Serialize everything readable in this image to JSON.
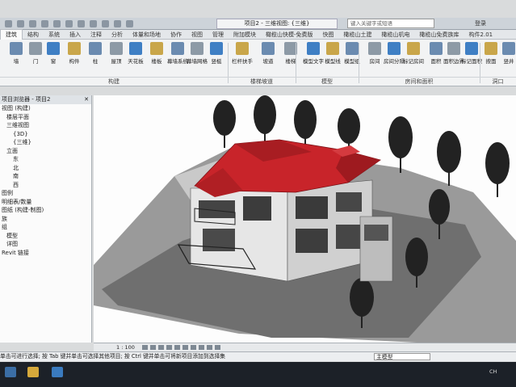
{
  "titlebar": {
    "document_title": "项目2 - 三维视图: {三维}",
    "search_placeholder": "键入关键字或短语",
    "user_label": "登录"
  },
  "ribbon_tabs": [
    {
      "label": "建筑",
      "active": true
    },
    {
      "label": "结构"
    },
    {
      "label": "系统"
    },
    {
      "label": "插入"
    },
    {
      "label": "注释"
    },
    {
      "label": "分析"
    },
    {
      "label": "体量和场地"
    },
    {
      "label": "协作"
    },
    {
      "label": "视图"
    },
    {
      "label": "管理"
    },
    {
      "label": "附加模块"
    },
    {
      "label": "橄榄山快模-免费版"
    },
    {
      "label": "快图"
    },
    {
      "label": "橄榄山土建"
    },
    {
      "label": "橄榄山机电"
    },
    {
      "label": "橄榄山免费族库"
    },
    {
      "label": "构件2.01"
    }
  ],
  "ribbon_tools": [
    {
      "label": "墙"
    },
    {
      "label": "门"
    },
    {
      "label": "窗"
    },
    {
      "label": "构件"
    },
    {
      "label": "柱"
    },
    {
      "label": "屋顶"
    },
    {
      "label": "天花板"
    },
    {
      "label": "楼板"
    },
    {
      "label": "幕墙系统"
    },
    {
      "label": "幕墙网格"
    },
    {
      "label": "竖梃"
    },
    {
      "label": "栏杆扶手"
    },
    {
      "label": "坡道"
    },
    {
      "label": "楼梯"
    },
    {
      "label": "模型文字"
    },
    {
      "label": "模型线"
    },
    {
      "label": "模型组"
    },
    {
      "label": "房间"
    },
    {
      "label": "房间分隔"
    },
    {
      "label": "标记房间"
    },
    {
      "label": "面积"
    },
    {
      "label": "面积边界"
    },
    {
      "label": "标记面积"
    },
    {
      "label": "按面"
    },
    {
      "label": "竖井"
    }
  ],
  "ribbon_groups": [
    "构建",
    "楼梯坡道",
    "模型",
    "房间和面积",
    "洞口"
  ],
  "browser": {
    "title": "项目浏览器 - 项目2",
    "close_icon": "x-icon",
    "items": [
      "视图 (构建)",
      "楼层平面",
      "三维视图",
      "{3D}",
      "{三维}",
      "立面",
      "东",
      "北",
      "南",
      "西",
      "图例",
      "明细表/数量",
      "图纸 (构建-制图)",
      "族",
      "组",
      "模型",
      "详图",
      "Revit 链接"
    ]
  },
  "viewbar": {
    "scale": "1 : 100"
  },
  "statusbar": {
    "message": "单击可进行选择; 按 Tab 键并单击可选择其他项目; 按 Ctrl 键并单击可将新项目添加到选择集",
    "model_label": "主模型"
  },
  "taskbar": {
    "clock": "CH"
  },
  "colors": {
    "roof": "#c8242a",
    "ground": "#7a7a7a",
    "wall": "#eaeaea",
    "ribbon_bg": "#f2f3f4"
  }
}
